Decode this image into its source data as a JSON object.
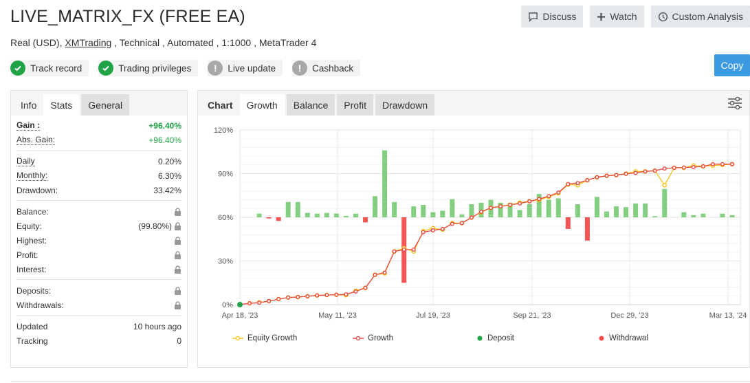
{
  "header": {
    "title": "LIVE_MATRIX_FX (FREE EA)",
    "subtitle_prefix": "Real (USD), ",
    "broker_link": "XMTrading",
    "subtitle_suffix": " , Technical , Automated , 1:1000 , MetaTrader 4"
  },
  "actions": {
    "discuss": "Discuss",
    "watch": "Watch",
    "custom_analysis": "Custom Analysis",
    "copy": "Copy"
  },
  "badges": [
    {
      "label": "Track record",
      "status": "ok"
    },
    {
      "label": "Trading privileges",
      "status": "ok"
    },
    {
      "label": "Live update",
      "status": "warning"
    },
    {
      "label": "Cashback",
      "status": "warning"
    }
  ],
  "left_tabs": {
    "info": "Info",
    "stats": "Stats",
    "general": "General"
  },
  "stats": {
    "gain_label": "Gain :",
    "gain_value": "+96.40%",
    "abs_gain_label": "Abs. Gain:",
    "abs_gain_value": "+96.40%",
    "daily_label": "Daily",
    "daily_value": "0.20%",
    "monthly_label": "Monthly:",
    "monthly_value": "6.30%",
    "drawdown_label": "Drawdown:",
    "drawdown_value": "33.42%",
    "balance_label": "Balance:",
    "equity_label": "Equity:",
    "equity_value": "(99.80%)",
    "highest_label": "Highest:",
    "profit_label": "Profit:",
    "interest_label": "Interest:",
    "deposits_label": "Deposits:",
    "withdrawals_label": "Withdrawals:",
    "updated_label": "Updated",
    "updated_value": "10 hours ago",
    "tracking_label": "Tracking",
    "tracking_value": "0"
  },
  "chart_tabs": {
    "chart": "Chart",
    "growth": "Growth",
    "balance": "Balance",
    "profit": "Profit",
    "drawdown": "Drawdown"
  },
  "colors": {
    "growth": "#e8433f",
    "equity": "#f5c518",
    "profit_positive": "#7ccb7a",
    "profit_negative": "#f24b4b",
    "deposit": "#1fa346",
    "withdrawal": "#f24b4b",
    "accent": "#3b9ae1"
  },
  "chart_data": {
    "type": "line",
    "title": "",
    "xlabel": "",
    "ylabel": "",
    "ylim": [
      0,
      120
    ],
    "yticks": [
      "0%",
      "30%",
      "60%",
      "90%",
      "120%"
    ],
    "ytick_values": [
      0,
      30,
      60,
      90,
      120
    ],
    "xtick_labels": [
      "Apr 18, '23",
      "May 11, '23",
      "Jul 19, '23",
      "Sep 21, '23",
      "Dec 29, '23",
      "Mar 13, '24"
    ],
    "xtick_index": [
      0,
      7,
      13,
      20,
      27,
      34
    ],
    "grid": true,
    "legend_position": "bottom",
    "legend": [
      "Equity Growth",
      "Growth",
      "Deposit",
      "Withdrawal"
    ],
    "n_points": 35,
    "series": [
      {
        "name": "Growth",
        "values": [
          0,
          0.9,
          1.3,
          2.4,
          3.8,
          4.9,
          5.2,
          5.7,
          6.3,
          6.6,
          6.8,
          7.0,
          9.0,
          11.5,
          20.5,
          22.0,
          36.5,
          37.8,
          37.8,
          49.8,
          51.0,
          52.0,
          55.5,
          56.0,
          59.8,
          63.8,
          66.5,
          67.5,
          68.5,
          69.5,
          71.0,
          72.5,
          74.5,
          77.0,
          82.8,
          83.5,
          85.5,
          87.5,
          88.5,
          89.0,
          89.8,
          90.5,
          91.5,
          92.0,
          93.5,
          94.0,
          94.2,
          94.5,
          95.0,
          96.5,
          96.5,
          96.5
        ]
      },
      {
        "name": "Equity Growth",
        "values": [
          0,
          0.9,
          1.5,
          2.4,
          3.8,
          4.9,
          5.2,
          5.7,
          6.3,
          6.6,
          6.8,
          6.5,
          9.5,
          11.5,
          20.5,
          21.5,
          36.5,
          38.8,
          36.5,
          50.5,
          52.5,
          51.5,
          56.0,
          56.0,
          59.8,
          63.5,
          66.5,
          67.5,
          68.5,
          70.0,
          71.0,
          72.0,
          74.0,
          76.5,
          82.5,
          82.0,
          85.5,
          87.5,
          88.5,
          89.0,
          90.0,
          91.5,
          91.5,
          92.0,
          82.0,
          94.0,
          94.0,
          95.5,
          95.0,
          95.5,
          96.0,
          96.5
        ]
      },
      {
        "name": "Profit",
        "axis": "secondary",
        "zero_at": 60,
        "values": [
          0,
          0,
          2.5,
          -0.8,
          -2.5,
          10.5,
          10.5,
          3,
          2.5,
          3,
          2.5,
          1,
          2.5,
          -3.5,
          14.5,
          46,
          10.5,
          -45,
          7.5,
          8.5,
          3.5,
          4.5,
          12.5,
          2,
          9,
          10,
          12,
          10,
          10,
          5,
          9,
          16,
          12,
          13,
          -8,
          9,
          -16,
          14,
          4,
          7.5,
          7,
          9.5,
          9.5,
          0.8,
          19.5,
          0,
          3.5,
          1.5,
          2.5,
          0,
          2.5,
          1.5
        ]
      },
      {
        "name": "Deposit",
        "type": "scatter",
        "points": [
          {
            "index": 0,
            "value": 0
          }
        ]
      }
    ]
  }
}
